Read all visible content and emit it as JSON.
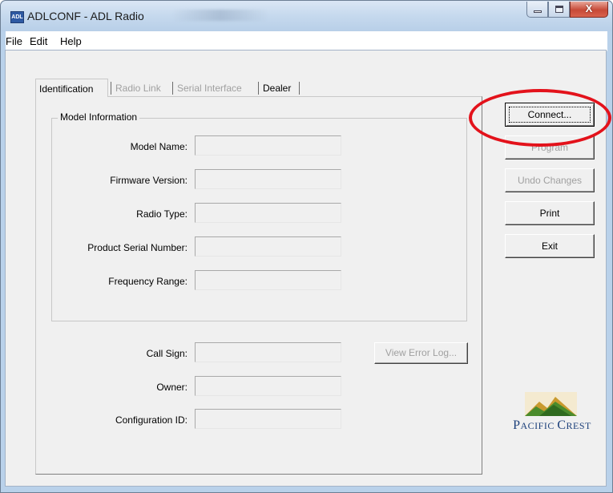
{
  "window": {
    "title": "ADLCONF - ADL Radio",
    "app_icon_text": "ADL",
    "close_glyph": "X"
  },
  "menu": [
    {
      "label": "File"
    },
    {
      "label": "Edit"
    },
    {
      "label": "Help"
    }
  ],
  "tabs": [
    {
      "label": "Identification",
      "state": "active"
    },
    {
      "label": "Radio Link",
      "state": "disabled"
    },
    {
      "label": "Serial Interface",
      "state": "disabled"
    },
    {
      "label": "Dealer",
      "state": "enabled"
    }
  ],
  "model_group": {
    "label": "Model Information",
    "fields": [
      {
        "label": "Model Name:",
        "value": ""
      },
      {
        "label": "Firmware Version:",
        "value": ""
      },
      {
        "label": "Radio Type:",
        "value": ""
      },
      {
        "label": "Product Serial Number:",
        "value": ""
      },
      {
        "label": "Frequency Range:",
        "value": ""
      }
    ]
  },
  "user_fields": [
    {
      "label": "Call Sign:",
      "value": ""
    },
    {
      "label": "Owner:",
      "value": ""
    },
    {
      "label": "Configuration ID:",
      "value": ""
    }
  ],
  "buttons": {
    "connect": "Connect...",
    "program": "Program",
    "undo": "Undo Changes",
    "print": "Print",
    "exit": "Exit",
    "view_error_log": "View Error Log..."
  },
  "logo": {
    "line1": "P",
    "line1_rest": "ACIFIC ",
    "line2": "C",
    "line2_rest": "REST"
  },
  "colors": {
    "highlight_circle": "#e3121b",
    "logo_blue": "#1b3f7a",
    "logo_green": "#4a8b2c",
    "logo_gold": "#c99a2e"
  }
}
